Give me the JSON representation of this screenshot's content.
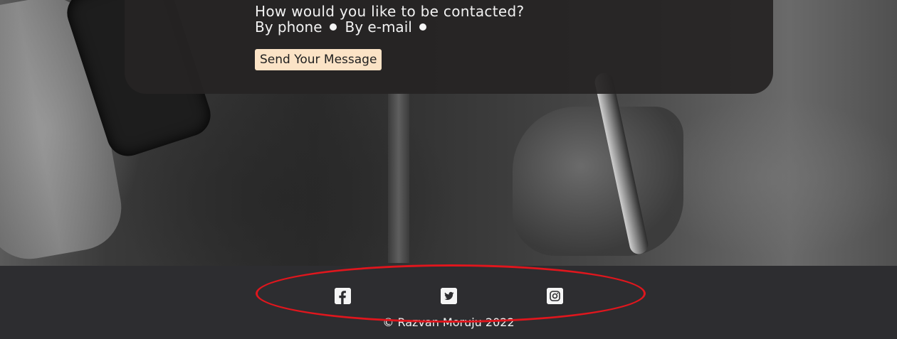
{
  "contact_form": {
    "question": "How would you like to be contacted?",
    "options": [
      {
        "label": "By phone"
      },
      {
        "label": "By e-mail"
      }
    ],
    "submit_label": "Send Your Message"
  },
  "footer": {
    "social": [
      {
        "name": "facebook",
        "icon": "facebook-icon"
      },
      {
        "name": "twitter",
        "icon": "twitter-icon"
      },
      {
        "name": "instagram",
        "icon": "instagram-icon"
      }
    ],
    "copyright": "© Razvan Moruju 2022"
  },
  "colors": {
    "panel": "#262324",
    "button": "#fbe3c6",
    "footer": "#2d2d30",
    "highlight": "#e0161d"
  }
}
